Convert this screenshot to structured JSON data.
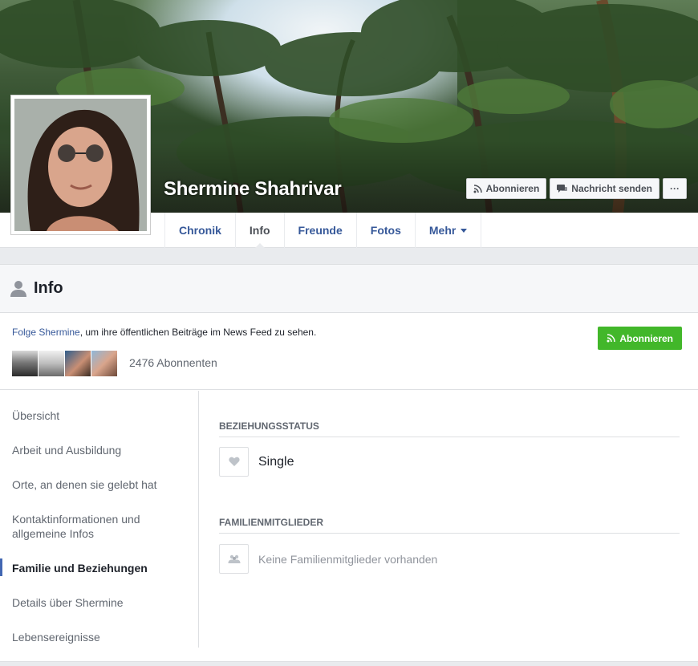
{
  "profile": {
    "name": "Shermine Shahrivar"
  },
  "cover_actions": {
    "subscribe_label": "Abonnieren",
    "message_label": "Nachricht senden",
    "more_label": "···"
  },
  "tabs": [
    {
      "label": "Chronik"
    },
    {
      "label": "Info"
    },
    {
      "label": "Freunde"
    },
    {
      "label": "Fotos"
    },
    {
      "label": "Mehr"
    }
  ],
  "info_header": {
    "title": "Info"
  },
  "follow": {
    "link": "Folge Shermine",
    "text": ", um ihre öffentlichen Beiträge im News Feed zu sehen.",
    "button_label": "Abonnieren",
    "subscribers": "2476 Abonnenten"
  },
  "sidebar": {
    "items": [
      {
        "label": "Übersicht"
      },
      {
        "label": "Arbeit und Ausbildung"
      },
      {
        "label": "Orte, an denen sie gelebt hat"
      },
      {
        "label": "Kontaktinformationen und allgemeine Infos"
      },
      {
        "label": "Familie und Beziehungen"
      },
      {
        "label": "Details über Shermine"
      },
      {
        "label": "Lebensereignisse"
      }
    ]
  },
  "relationship": {
    "title": "BEZIEHUNGSSTATUS",
    "status": "Single"
  },
  "family": {
    "title": "FAMILIENMITGLIEDER",
    "empty": "Keine Familienmitglieder vorhanden"
  },
  "colors": {
    "link": "#365899",
    "follow_green": "#42b72a",
    "active_bar": "#4267b2"
  }
}
